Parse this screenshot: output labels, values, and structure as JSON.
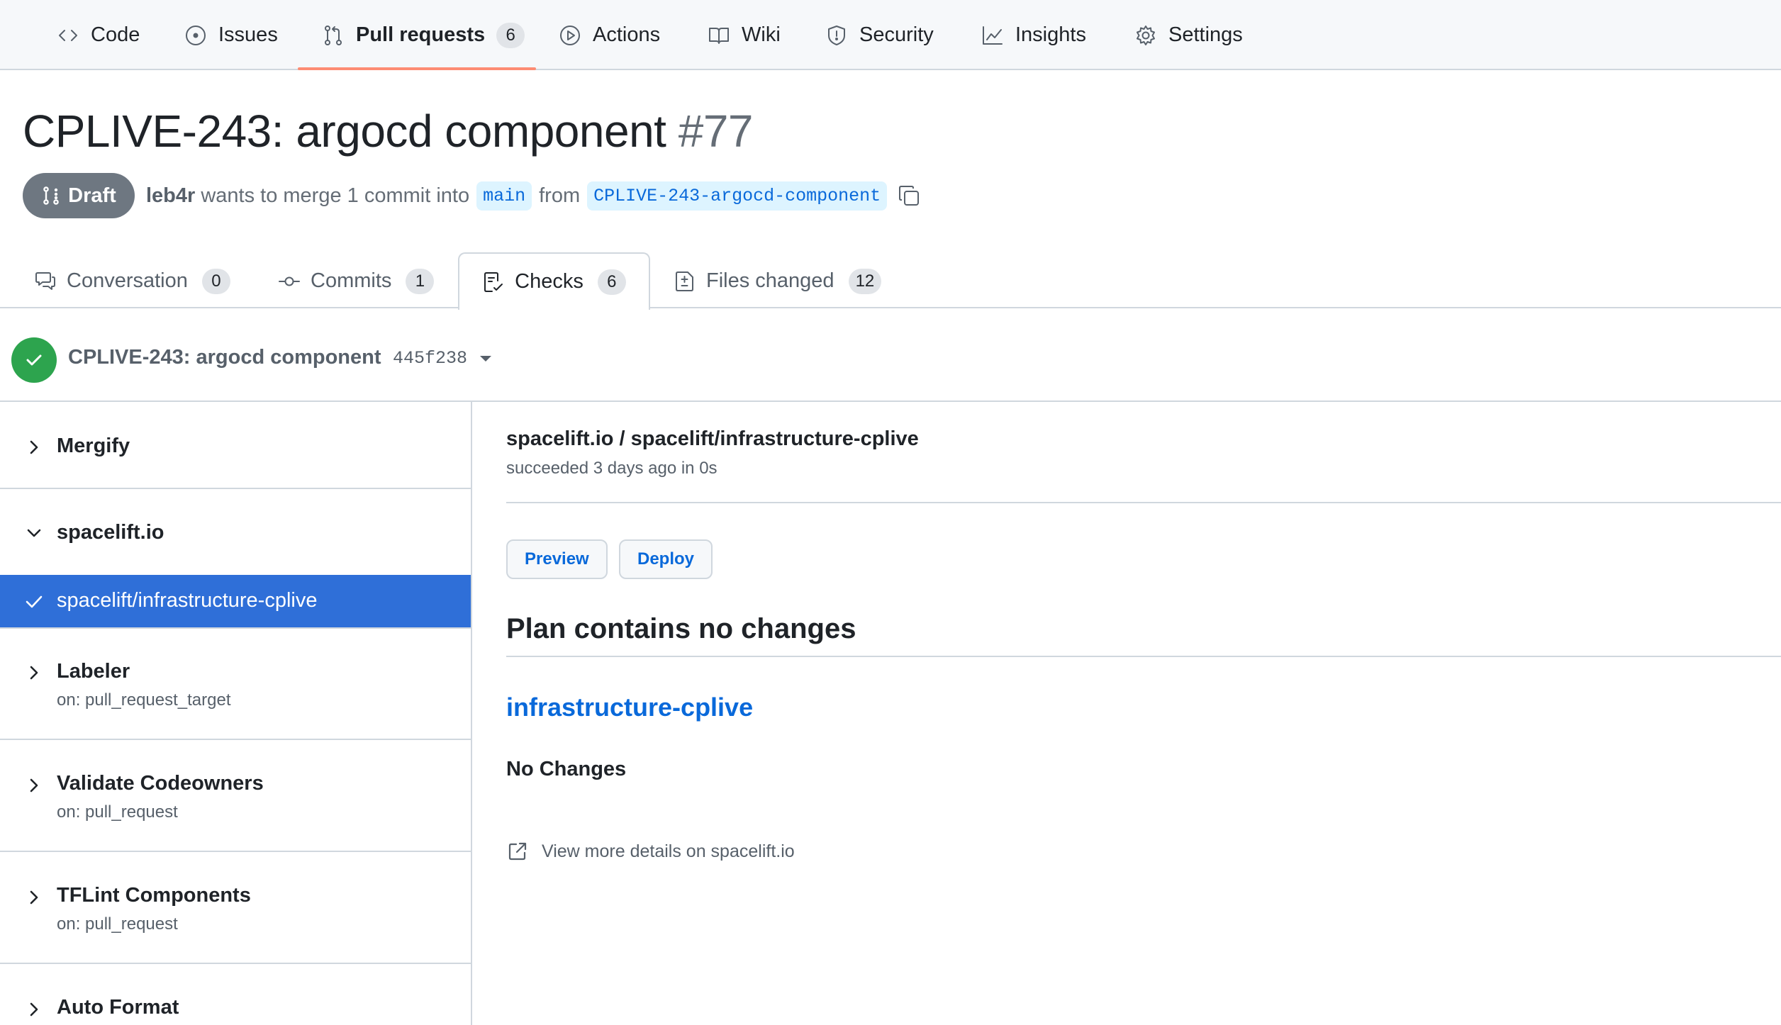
{
  "repo_nav": {
    "items": [
      {
        "label": "Code",
        "icon": "code-icon"
      },
      {
        "label": "Issues",
        "icon": "issue-icon"
      },
      {
        "label": "Pull requests",
        "icon": "pull-request-icon",
        "count": "6",
        "active": true
      },
      {
        "label": "Actions",
        "icon": "play-icon"
      },
      {
        "label": "Wiki",
        "icon": "book-icon"
      },
      {
        "label": "Security",
        "icon": "shield-icon"
      },
      {
        "label": "Insights",
        "icon": "graph-icon"
      },
      {
        "label": "Settings",
        "icon": "gear-icon"
      }
    ],
    "active_underline_color": "#fd8c73"
  },
  "pr": {
    "title": "CPLIVE-243: argocd component",
    "number": "#77",
    "state_badge": "Draft",
    "author": "leb4r",
    "merge_text": "wants to merge 1 commit into",
    "base_branch": "main",
    "from_text": "from",
    "head_branch": "CPLIVE-243-argocd-component"
  },
  "pr_tabs": [
    {
      "label": "Conversation",
      "count": "0",
      "icon": "comment-icon"
    },
    {
      "label": "Commits",
      "count": "1",
      "icon": "commit-icon"
    },
    {
      "label": "Checks",
      "count": "6",
      "icon": "checklist-icon",
      "active": true
    },
    {
      "label": "Files changed",
      "count": "12",
      "icon": "file-diff-icon"
    }
  ],
  "checks_header": {
    "title": "CPLIVE-243: argocd component",
    "sha": "445f238",
    "status_color": "#2da44e"
  },
  "sidebar": {
    "groups": [
      {
        "title": "Mergify",
        "expanded": false
      },
      {
        "title": "spacelift.io",
        "expanded": true
      },
      {
        "title": "Labeler",
        "subtitle": "on: pull_request_target",
        "expanded": false
      },
      {
        "title": "Validate Codeowners",
        "subtitle": "on: pull_request",
        "expanded": false
      },
      {
        "title": "TFLint Components",
        "subtitle": "on: pull_request",
        "expanded": false
      },
      {
        "title": "Auto Format",
        "expanded": false
      }
    ],
    "selected_item": "spacelift/infrastructure-cplive",
    "selected_color": "#2f6fd8"
  },
  "detail": {
    "title": "spacelift.io / spacelift/infrastructure-cplive",
    "subtitle": "succeeded 3 days ago in 0s",
    "buttons": [
      "Preview",
      "Deploy"
    ],
    "heading": "Plan contains no changes",
    "stack_link": "infrastructure-cplive",
    "no_changes": "No Changes",
    "more_details": "View more details on spacelift.io"
  }
}
